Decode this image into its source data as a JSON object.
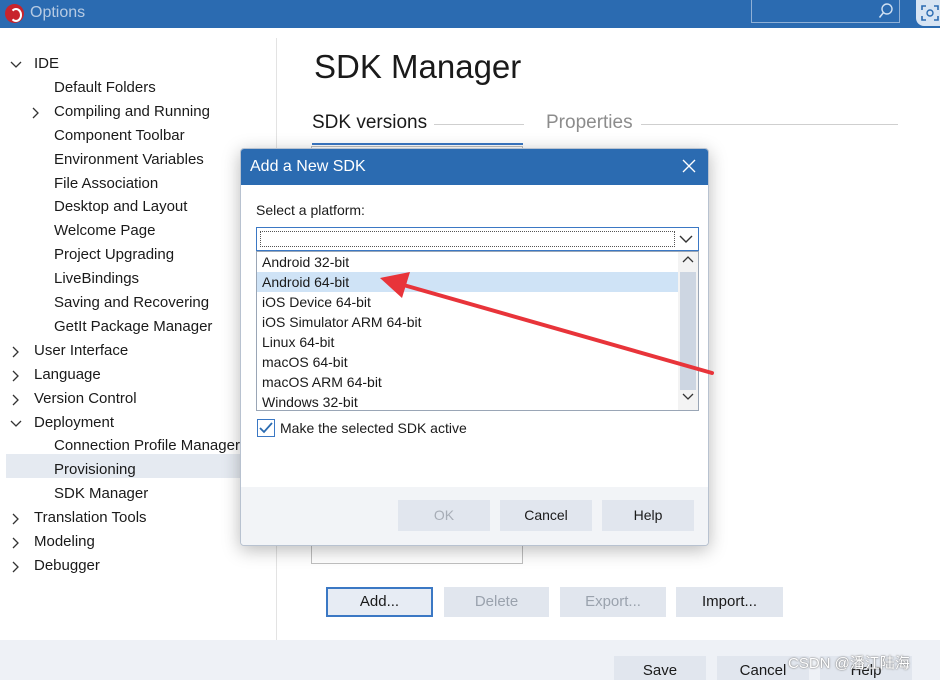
{
  "window": {
    "title": "Options"
  },
  "tree": {
    "items": [
      {
        "label": "IDE",
        "expanded": true
      },
      {
        "label": "Default Folders"
      },
      {
        "label": "Compiling and Running",
        "expanded": false
      },
      {
        "label": "Component Toolbar"
      },
      {
        "label": "Environment Variables"
      },
      {
        "label": "File Association"
      },
      {
        "label": "Desktop and Layout"
      },
      {
        "label": "Welcome Page"
      },
      {
        "label": "Project Upgrading"
      },
      {
        "label": "LiveBindings"
      },
      {
        "label": "Saving and Recovering"
      },
      {
        "label": "GetIt Package Manager"
      },
      {
        "label": "User Interface",
        "expanded": false
      },
      {
        "label": "Language",
        "expanded": false
      },
      {
        "label": "Version Control",
        "expanded": false
      },
      {
        "label": "Deployment",
        "expanded": true
      },
      {
        "label": "Connection Profile Manager"
      },
      {
        "label": "Provisioning"
      },
      {
        "label": "SDK Manager",
        "selected": true
      },
      {
        "label": "Translation Tools",
        "expanded": false
      },
      {
        "label": "Modeling",
        "expanded": false
      },
      {
        "label": "Debugger",
        "expanded": false
      }
    ]
  },
  "main": {
    "title": "SDK Manager",
    "tabs": [
      {
        "label": "SDK versions",
        "active": true
      },
      {
        "label": "Properties",
        "active": false
      }
    ],
    "buttons": {
      "add": "Add...",
      "delete": "Delete",
      "export": "Export...",
      "import": "Import..."
    }
  },
  "footer": {
    "save": "Save",
    "cancel": "Cancel",
    "help": "Help"
  },
  "dialog": {
    "title": "Add a New SDK",
    "platform_label": "Select a platform:",
    "combo_value": "",
    "platforms": [
      "Android 32-bit",
      "Android 64-bit",
      "iOS Device 64-bit",
      "iOS Simulator ARM 64-bit",
      "Linux 64-bit",
      "macOS 64-bit",
      "macOS ARM 64-bit",
      "Windows 32-bit"
    ],
    "highlighted": "Android 64-bit",
    "make_active_label": "Make the selected SDK active",
    "make_active_checked": true,
    "ok": "OK",
    "cancel": "Cancel",
    "help": "Help"
  },
  "watermark": "CSDN @潘江陆海",
  "colors": {
    "title_bar": "#2b6bb1",
    "annotation_arrow": "#e8343a",
    "highlight": "#cfe3f6"
  }
}
